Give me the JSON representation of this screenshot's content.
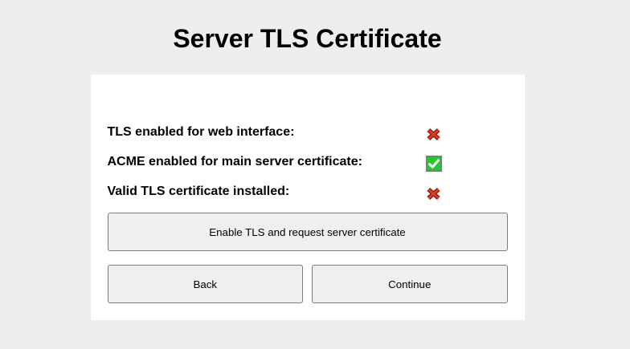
{
  "title": "Server TLS Certificate",
  "colors": {
    "page_background": "#eeeeee",
    "card_background": "#ffffff",
    "button_background": "#efefef",
    "button_border": "#7c7c7c",
    "cross_fill": "#e13b26",
    "cross_outline": "#7f170c",
    "checkbox_green": "#26c831",
    "checkbox_border": "#787878",
    "checkmark": "#ffffff"
  },
  "status_rows": [
    {
      "label": "TLS enabled for web interface:",
      "status": "no",
      "icon": "red-cross-icon"
    },
    {
      "label": "ACME enabled for main server certificate:",
      "status": "yes",
      "icon": "green-checkbox-icon"
    },
    {
      "label": "Valid TLS certificate installed:",
      "status": "no",
      "icon": "red-cross-icon"
    }
  ],
  "buttons": {
    "primary": "Enable TLS and request server certificate",
    "back": "Back",
    "continue": "Continue"
  }
}
